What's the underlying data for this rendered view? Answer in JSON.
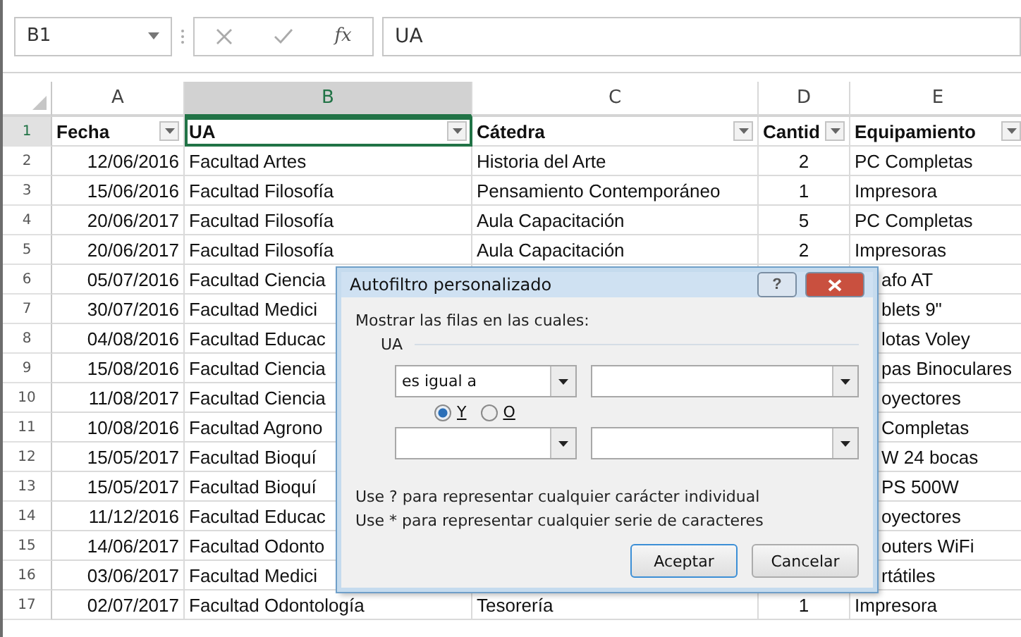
{
  "formula_bar": {
    "name_box": "B1",
    "function_symbol": "fx",
    "value": "UA"
  },
  "columns": [
    {
      "label": "A",
      "selected": false
    },
    {
      "label": "B",
      "selected": true
    },
    {
      "label": "C",
      "selected": false
    },
    {
      "label": "D",
      "selected": false
    },
    {
      "label": "E",
      "selected": false
    }
  ],
  "header_row": {
    "number": "1",
    "cells": [
      "Fecha",
      "UA",
      "Cátedra",
      "Cantid",
      "Equipamiento"
    ]
  },
  "rows": [
    {
      "number": "2",
      "cells": [
        "12/06/2016",
        "Facultad Artes",
        "Historia del Arte",
        "2",
        "PC Completas"
      ]
    },
    {
      "number": "3",
      "cells": [
        "15/06/2016",
        "Facultad Filosofía",
        "Pensamiento Contemporáneo",
        "1",
        "Impresora"
      ]
    },
    {
      "number": "4",
      "cells": [
        "20/06/2017",
        "Facultad Filosofía",
        "Aula Capacitación",
        "5",
        "PC Completas"
      ]
    },
    {
      "number": "5",
      "cells": [
        "20/06/2017",
        "Facultad Filosofía",
        "Aula Capacitación",
        "2",
        "Impresoras"
      ]
    },
    {
      "number": "6",
      "cells": [
        "05/07/2016",
        "Facultad Ciencia",
        null,
        null,
        "afo AT"
      ]
    },
    {
      "number": "7",
      "cells": [
        "30/07/2016",
        "Facultad Medici",
        null,
        null,
        "blets 9\""
      ]
    },
    {
      "number": "8",
      "cells": [
        "04/08/2016",
        "Facultad Educac",
        null,
        null,
        "lotas Voley"
      ]
    },
    {
      "number": "9",
      "cells": [
        "15/08/2016",
        "Facultad Ciencia",
        null,
        null,
        "pas Binoculares"
      ]
    },
    {
      "number": "10",
      "cells": [
        "11/08/2017",
        "Facultad Ciencia",
        null,
        null,
        "oyectores"
      ]
    },
    {
      "number": "11",
      "cells": [
        "10/08/2016",
        "Facultad Agrono",
        null,
        null,
        "Completas"
      ]
    },
    {
      "number": "12",
      "cells": [
        "15/05/2017",
        "Facultad Bioquí",
        null,
        null,
        "W 24 bocas"
      ]
    },
    {
      "number": "13",
      "cells": [
        "15/05/2017",
        "Facultad Bioquí",
        null,
        null,
        "PS 500W"
      ]
    },
    {
      "number": "14",
      "cells": [
        "11/12/2016",
        "Facultad Educac",
        null,
        null,
        "oyectores"
      ]
    },
    {
      "number": "15",
      "cells": [
        "14/06/2017",
        "Facultad Odonto",
        null,
        null,
        "outers WiFi"
      ]
    },
    {
      "number": "16",
      "cells": [
        "03/06/2017",
        "Facultad Medici",
        null,
        null,
        "rtátiles"
      ]
    },
    {
      "number": "17",
      "cells": [
        "02/07/2017",
        "Facultad Odontología",
        "Tesorería",
        "1",
        "Impresora"
      ]
    }
  ],
  "dialog": {
    "title": "Autofiltro personalizado",
    "help": "?",
    "prompt": "Mostrar las filas en las cuales:",
    "field_group": "UA",
    "conditions": [
      {
        "operator": "es igual a"
      },
      {
        "joins": [
          {
            "label": "Y",
            "selected": true
          },
          {
            "label": "O",
            "selected": false
          }
        ]
      }
    ],
    "hints": [
      "Use ? para representar cualquier carácter individual",
      "Use * para representar cualquier serie de caracteres"
    ],
    "buttons": [
      {
        "label": "Aceptar",
        "default": true
      },
      {
        "label": "Cancelar",
        "default": false
      }
    ]
  }
}
